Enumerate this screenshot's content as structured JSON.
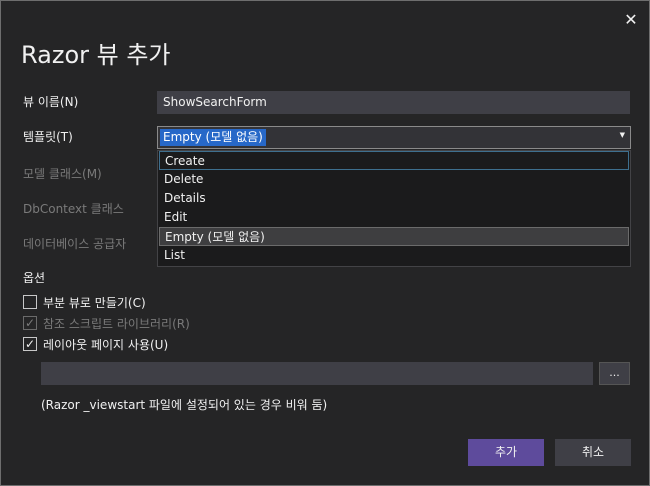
{
  "dialog": {
    "title": "Razor 뷰 추가",
    "close_label": "✕"
  },
  "fields": {
    "view_name_label": "뷰 이름(N)",
    "view_name_value": "ShowSearchForm",
    "template_label": "템플릿(T)",
    "template_value": "Empty (모델 없음)",
    "model_class_label": "모델 클래스(M)",
    "dbcontext_label": "DbContext 클래스",
    "database_provider_label": "데이터베이스 공급자"
  },
  "template_dropdown": {
    "options": [
      "Create",
      "Delete",
      "Details",
      "Edit",
      "Empty (모델 없음)",
      "List"
    ],
    "focused": "Create",
    "highlighted": "Empty (모델 없음)"
  },
  "options": {
    "section_label": "옵션",
    "partial_view": {
      "label": "부분 뷰로 만들기(C)",
      "checked": false,
      "enabled": true
    },
    "reference_scripts": {
      "label": "참조 스크립트 라이브러리(R)",
      "checked": true,
      "enabled": false
    },
    "use_layout": {
      "label": "레이아웃 페이지 사용(U)",
      "checked": true,
      "enabled": true
    },
    "layout_path_value": "",
    "browse_label": "...",
    "layout_note": "(Razor _viewstart 파일에 설정되어 있는 경우 비워 둠)"
  },
  "buttons": {
    "add_label": "추가",
    "cancel_label": "취소"
  },
  "icons": {
    "close": "close-icon",
    "dropdown": "chevron-down-icon",
    "check": "checkmark-icon"
  },
  "colors": {
    "background": "#252526",
    "primary_button": "#5e4b9c",
    "selection": "#2768c8"
  }
}
